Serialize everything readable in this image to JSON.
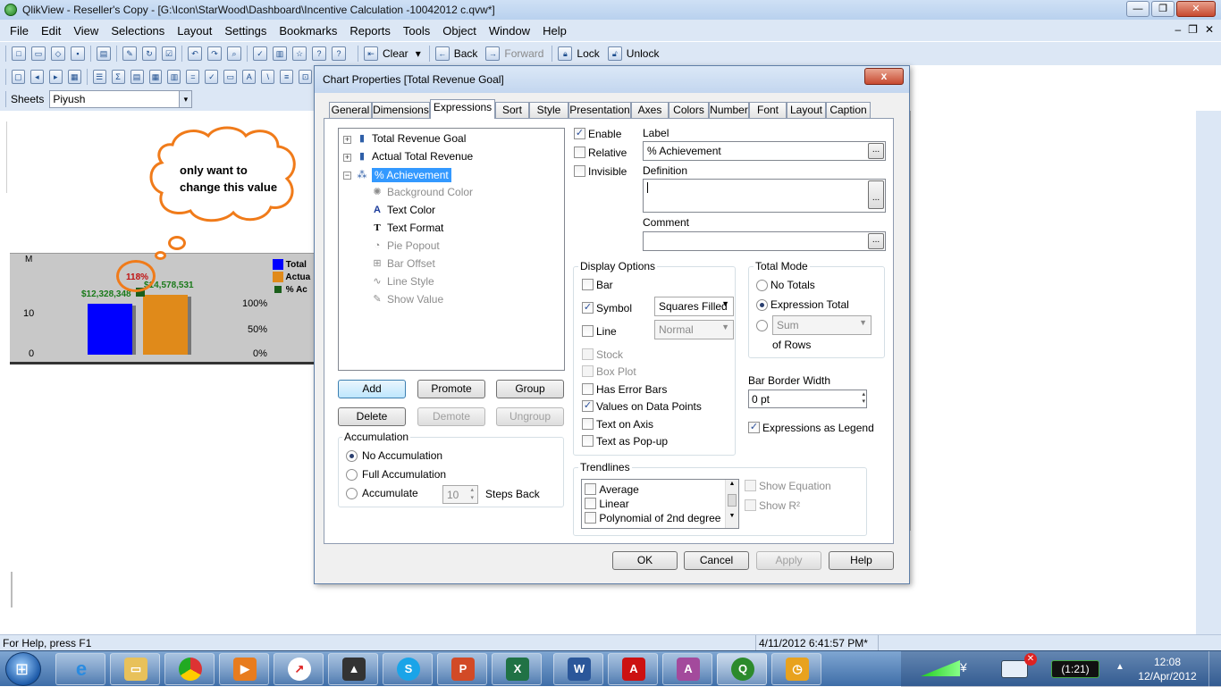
{
  "window": {
    "title": "QlikView - Reseller's Copy - [G:\\Icon\\StarWood\\Dashboard\\Incentive Calculation -10042012 c.qvw*]"
  },
  "menu": [
    "File",
    "Edit",
    "View",
    "Selections",
    "Layout",
    "Settings",
    "Bookmarks",
    "Reports",
    "Tools",
    "Object",
    "Window",
    "Help"
  ],
  "toolbar": {
    "clear": "Clear",
    "back": "Back",
    "forward": "Forward",
    "lock": "Lock",
    "unlock": "Unlock"
  },
  "sheets": {
    "label": "Sheets",
    "selected": "Piyush"
  },
  "sheet_chart": {
    "axis_label": "M",
    "ticks_left": [
      "10",
      "0"
    ],
    "ticks_right": [
      "100%",
      "50%",
      "0%"
    ],
    "value_a": "$12,328,348",
    "value_b": "$14,578,531",
    "pct_label": "118%",
    "legend": [
      "Total",
      "Actua",
      "% Ac"
    ],
    "legend_colors": [
      "#0000ff",
      "#e08a1a",
      "#1a5e1a"
    ]
  },
  "callout": {
    "line1": "only want to",
    "line2": "change this value"
  },
  "dialog": {
    "title": "Chart Properties [Total Revenue Goal]",
    "close": "x",
    "tabs": [
      "General",
      "Dimensions",
      "Expressions",
      "Sort",
      "Style",
      "Presentation",
      "Axes",
      "Colors",
      "Number",
      "Font",
      "Layout",
      "Caption"
    ],
    "active_tab": "Expressions",
    "tree": {
      "expr1": "Total Revenue Goal",
      "expr2": "Actual Total Revenue",
      "expr3": "% Achievement",
      "attrs": [
        "Background Color",
        "Text Color",
        "Text Format",
        "Pie Popout",
        "Bar Offset",
        "Line Style",
        "Show Value"
      ]
    },
    "buttons": {
      "add": "Add",
      "promote": "Promote",
      "group": "Group",
      "delete": "Delete",
      "demote": "Demote",
      "ungroup": "Ungroup"
    },
    "accumulation": {
      "title": "Accumulation",
      "none": "No Accumulation",
      "full": "Full Accumulation",
      "acc": "Accumulate",
      "steps_value": "10",
      "steps_back": "Steps Back"
    },
    "enable": "Enable",
    "relative": "Relative",
    "invisible": "Invisible",
    "label_title": "Label",
    "label_value": "% Achievement",
    "definition_title": "Definition",
    "definition_value": "",
    "comment_title": "Comment",
    "ellipsis": "...",
    "display_options": {
      "title": "Display Options",
      "bar": "Bar",
      "symbol": "Symbol",
      "symbol_value": "Squares Filled",
      "line": "Line",
      "line_value": "Normal",
      "stock": "Stock",
      "boxplot": "Box Plot",
      "error_bars": "Has Error Bars",
      "values_on_points": "Values on Data Points",
      "text_on_axis": "Text on Axis",
      "text_popup": "Text as Pop-up"
    },
    "total_mode": {
      "title": "Total Mode",
      "no_totals": "No Totals",
      "expr_total": "Expression Total",
      "sum": "Sum",
      "of_rows": "of Rows"
    },
    "bar_border": {
      "title": "Bar Border Width",
      "value": "0 pt"
    },
    "expr_legend": "Expressions as Legend",
    "trendlines": {
      "title": "Trendlines",
      "items": [
        "Average",
        "Linear",
        "Polynomial of 2nd degree"
      ],
      "show_equation": "Show Equation",
      "show_r2": "Show R²"
    },
    "footer": {
      "ok": "OK",
      "cancel": "Cancel",
      "apply": "Apply",
      "help": "Help"
    }
  },
  "status": {
    "help": "For Help, press F1",
    "datetime": "4/11/2012 6:41:57 PM*"
  },
  "taskbar": {
    "clock_time": "12:08",
    "clock_date": "12/Apr/2012",
    "battery": "(1:21)"
  }
}
